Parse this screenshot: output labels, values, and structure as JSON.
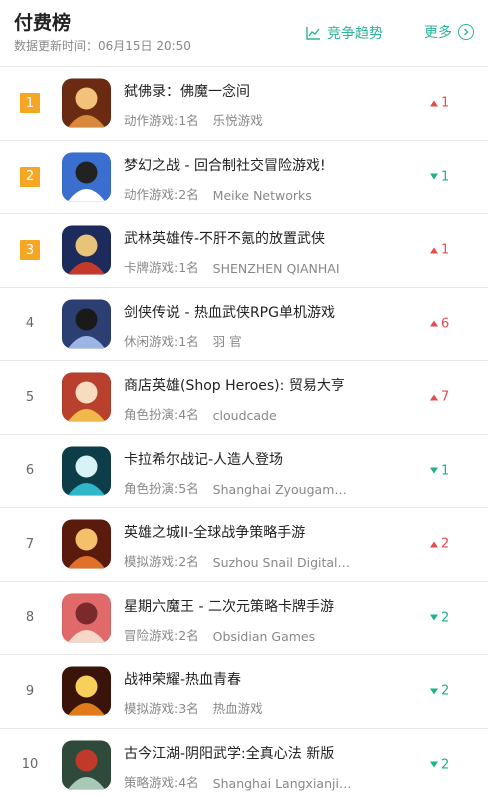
{
  "header": {
    "title": "付费榜",
    "update_time": "数据更新时间：06月15日 20:50",
    "compete_label": "竞争趋势",
    "more_label": "更多"
  },
  "colors": {
    "accent": "#2db59a",
    "rank_badge": "#f5a623",
    "up": "#e64c4c",
    "down": "#1bb28c"
  },
  "apps": [
    {
      "rank": "1",
      "name": "弑佛录：佛魔一念间",
      "category": "动作游戏:1名",
      "developer": "乐悦游戏",
      "change": "1",
      "direction": "up",
      "icon": "buddha-warrior-icon"
    },
    {
      "rank": "2",
      "name": "梦幻之战 - 回合制社交冒险游戏!",
      "category": "动作游戏:2名",
      "developer": "Meike Networks",
      "change": "1",
      "direction": "down",
      "icon": "panda-hero-icon"
    },
    {
      "rank": "3",
      "name": "武林英雄传-不肝不氪的放置武侠",
      "category": "卡牌游戏:1名",
      "developer": "SHENZHEN QIANHAI",
      "change": "1",
      "direction": "up",
      "icon": "martial-hero-icon"
    },
    {
      "rank": "4",
      "name": "剑侠传说 - 热血武侠RPG单机游戏",
      "category": "休闲游戏:1名",
      "developer": "羽 官",
      "change": "6",
      "direction": "up",
      "icon": "masked-swordsman-icon"
    },
    {
      "rank": "5",
      "name": "商店英雄(Shop Heroes): 贸易大亨",
      "category": "角色扮演:4名",
      "developer": "cloudcade",
      "change": "7",
      "direction": "up",
      "icon": "shop-heroine-icon"
    },
    {
      "rank": "6",
      "name": "卡拉希尔战记-人造人登场",
      "category": "角色扮演:5名",
      "developer": "Shanghai Zyougame Network",
      "change": "1",
      "direction": "down",
      "icon": "pirate-ship-icon"
    },
    {
      "rank": "7",
      "name": "英雄之城II-全球战争策略手游",
      "category": "模拟游戏:2名",
      "developer": "Suzhou Snail Digital Technology",
      "change": "2",
      "direction": "up",
      "icon": "spartan-warrior-icon"
    },
    {
      "rank": "8",
      "name": "星期六魔王 - 二次元策略卡牌手游",
      "category": "冒险游戏:2名",
      "developer": "Obsidian Games",
      "change": "2",
      "direction": "down",
      "icon": "anime-ninja-icon"
    },
    {
      "rank": "9",
      "name": "战神荣耀-热血青春",
      "category": "模拟游戏:3名",
      "developer": "热血游戏",
      "change": "2",
      "direction": "down",
      "icon": "flaming-sword-icon"
    },
    {
      "rank": "10",
      "name": "古今江湖-阴阳武学:全真心法 新版",
      "category": "策略游戏:4名",
      "developer": "Shanghai Langxianji Network",
      "change": "2",
      "direction": "down",
      "icon": "ink-warrior-icon"
    }
  ]
}
